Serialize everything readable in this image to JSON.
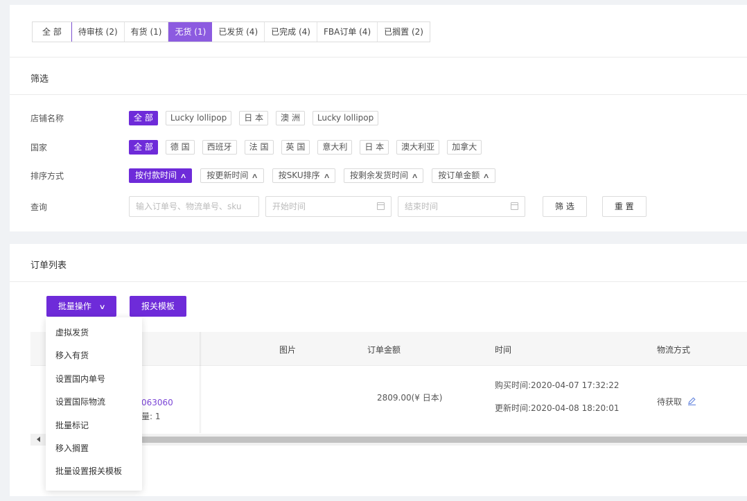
{
  "tabs": [
    {
      "label": "全 部",
      "active": false
    },
    {
      "label": "待审核 (2)",
      "active": false
    },
    {
      "label": "有货 (1)",
      "active": false
    },
    {
      "label": "无货 (1)",
      "active": true
    },
    {
      "label": "已发货 (4)",
      "active": false
    },
    {
      "label": "已完成 (4)",
      "active": false
    },
    {
      "label": "FBA订单 (4)",
      "active": false
    },
    {
      "label": "已搁置 (2)",
      "active": false
    }
  ],
  "filter": {
    "title": "筛选",
    "shop": {
      "label": "店铺名称",
      "options": [
        "全 部",
        "Lucky lollipop",
        "日 本",
        "澳 洲",
        "Lucky lollipop"
      ]
    },
    "country": {
      "label": "国家",
      "options": [
        "全 部",
        "德 国",
        "西班牙",
        "法 国",
        "英 国",
        "意大利",
        "日 本",
        "澳大利亚",
        "加拿大"
      ]
    },
    "sort": {
      "label": "排序方式",
      "options": [
        "按付款时间",
        "按更新时间",
        "按SKU排序",
        "按剩余发货时间",
        "按订单金额"
      ]
    },
    "query": {
      "label": "查询",
      "keyword_placeholder": "输入订单号、物流单号、sku",
      "start_placeholder": "开始时间",
      "end_placeholder": "结束时间",
      "filter_button": "筛 选",
      "reset_button": "重 置"
    }
  },
  "orders": {
    "title": "订单列表",
    "batch_button": "批量操作",
    "customs_button": "报关模板",
    "columns": {
      "image": "图片",
      "amount": "订单金额",
      "time": "时间",
      "shipping": "物流方式"
    },
    "row": {
      "order_no_partial": "063060",
      "qty_partial": "量: 1",
      "amount": "2809.00(¥ 日本)",
      "purchase_time": "购买时间:2020-04-07 17:32:22",
      "update_time": "更新时间:2020-04-08 18:20:01",
      "shipping": "待获取"
    },
    "batch_menu": [
      "虚拟发货",
      "移入有货",
      "设置国内单号",
      "设置国际物流",
      "批量标记",
      "移入搁置",
      "批量设置报关模板"
    ]
  },
  "colors": {
    "accent": "#6e2bd9",
    "active_tab": "#8c5be0",
    "link": "#7b45d6"
  }
}
